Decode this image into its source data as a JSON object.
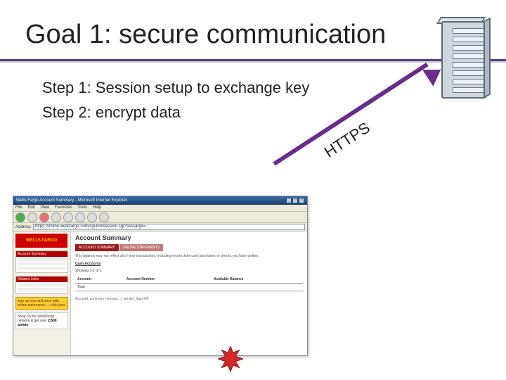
{
  "title": "Goal 1: secure communication",
  "steps": [
    "Step 1:  Session setup to exchange key",
    "Step 2:  encrypt data"
  ],
  "arrow_label": "HTTPS",
  "browser": {
    "window_title": "Wells Fargo Account Summary - Microsoft Internet Explorer",
    "menus": [
      "File",
      "Edit",
      "View",
      "Favorites",
      "Tools",
      "Help"
    ],
    "address_label": "Address",
    "url": "https://online.wellsfargo.com/cgi-bin/session.cgi?sessargs=…",
    "logo": "WELLS FARGO",
    "sidebar_panels": [
      {
        "title": "Account Summary"
      },
      {
        "title": "Related Links"
      }
    ],
    "promo1": "sign up now and save with online statements — click here",
    "promo2_label": "Shop on the WellsShop network & get over",
    "promo2_value": "2,500 points",
    "page_title": "Account Summary",
    "tabs": [
      "ACCOUNT SUMMARY",
      "ONLINE STATEMENTS"
    ],
    "note": "This balance may not reflect all of your transactions, including recent debit card purchases or checks you have written.",
    "account_label": "Cash Accounts",
    "showing_label": "Showing",
    "showing_value": "1-1 of 1",
    "table_headers": [
      "Account",
      "Account Number",
      "Available Balance"
    ],
    "footer_note": "Account_summary (version…) servlet_Sign Off"
  }
}
